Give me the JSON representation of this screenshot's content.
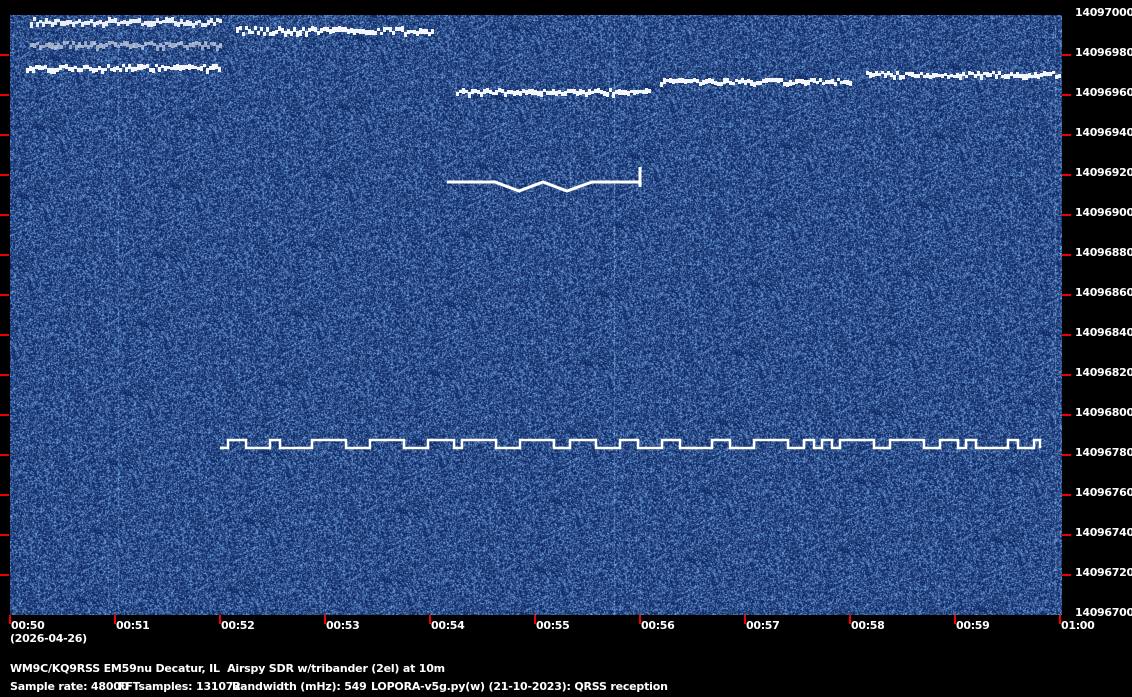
{
  "spectrogram": {
    "freq_labels": [
      "14097000",
      "14096980",
      "14096960",
      "14096940",
      "14096920",
      "14096900",
      "14096880",
      "14096860",
      "14096840",
      "14096820",
      "14096800",
      "14096780",
      "14096760",
      "14096740",
      "14096720",
      "14096700"
    ],
    "time_labels": [
      "00:50",
      "00:51",
      "00:52",
      "00:53",
      "00:54",
      "00:55",
      "00:56",
      "00:57",
      "00:58",
      "00:59",
      "01:00"
    ],
    "date_label": "(2026-04-26)",
    "colors": {
      "background": "#0b2d6b",
      "signal": "#ffffff",
      "tick": "#e00000"
    }
  },
  "footer": {
    "station": "WM9C/KQ9RSS EM59nu Decatur, IL  Airspy SDR w/tribander (2el) at 10m",
    "sample_rate": "Sample rate: 48000",
    "fft_samples": "FFTsamples: 131072",
    "bandwidth": "Bandwidth (mHz): 549",
    "software": "LOPORA-v5g.py(w) (21-10-2023): QRSS reception"
  }
}
